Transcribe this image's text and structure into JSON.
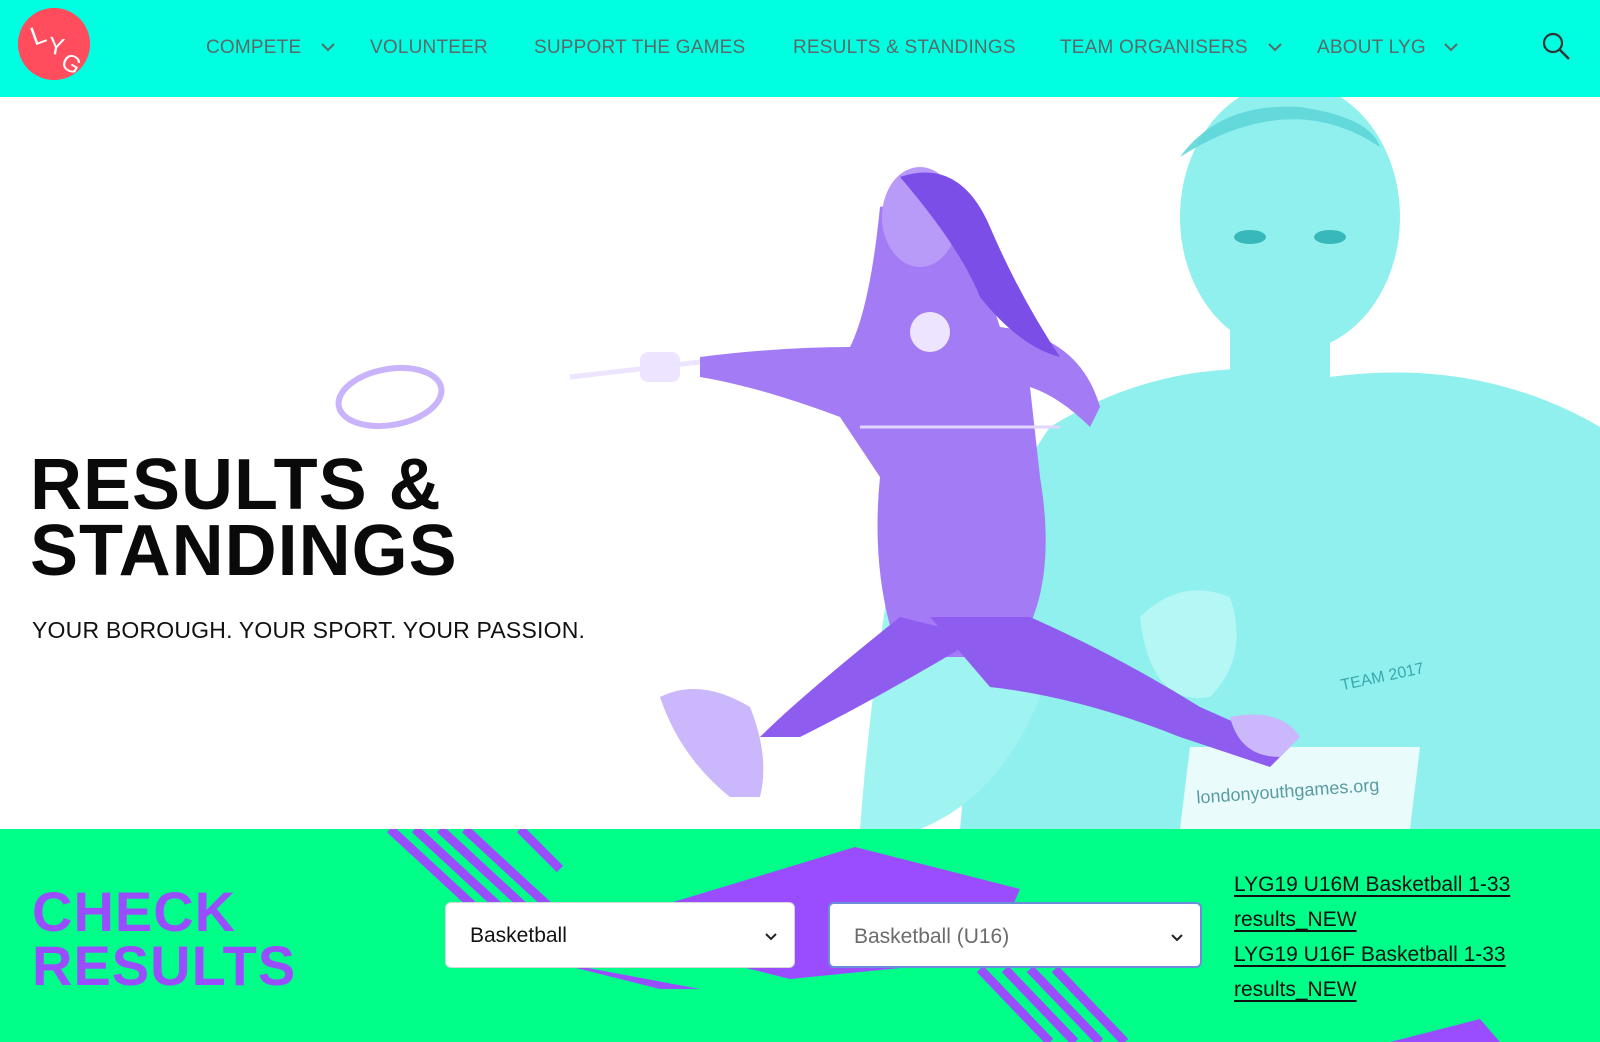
{
  "header": {
    "logo_text": "LYG",
    "nav": [
      {
        "label": "COMPETE",
        "has_dropdown": true
      },
      {
        "label": "VOLUNTEER",
        "has_dropdown": false
      },
      {
        "label": "SUPPORT THE GAMES",
        "has_dropdown": false
      },
      {
        "label": "RESULTS & STANDINGS",
        "has_dropdown": false
      },
      {
        "label": "TEAM ORGANISERS",
        "has_dropdown": true
      },
      {
        "label": "ABOUT LYG",
        "has_dropdown": true
      }
    ],
    "search_icon": "search-icon"
  },
  "hero": {
    "title_line1": "RESULTS &",
    "title_line2": "STANDINGS",
    "subtitle": "YOUR BOROUGH. YOUR SPORT. YOUR PASSION.",
    "photo_text": {
      "bib": "londonyouthgames.org",
      "shirt": "TEAM 2017"
    }
  },
  "results": {
    "title_line1": "CHECK",
    "title_line2": "RESULTS",
    "sport_select": {
      "value": "Basketball"
    },
    "category_select": {
      "value": "Basketball (U16)"
    },
    "links": [
      {
        "label": "LYG19 U16M Basketball 1-33 results_NEW"
      },
      {
        "label": "LYG19 U16F Basketball 1-33 results_NEW"
      }
    ]
  },
  "colors": {
    "header_bg": "#00ffe1",
    "band_bg": "#00ff88",
    "accent_purple": "#9a4dff",
    "logo_red": "#ff4d5e",
    "cyan_figure": "#7fe9ea"
  }
}
